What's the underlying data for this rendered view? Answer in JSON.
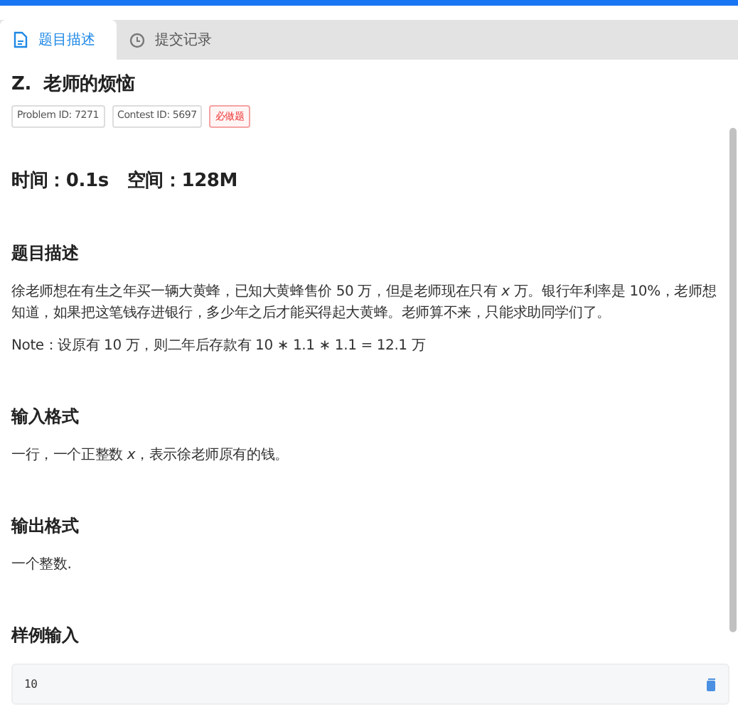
{
  "tabs": [
    {
      "label": "题目描述",
      "kind": "description",
      "selected": true
    },
    {
      "label": "提交记录",
      "kind": "submissions",
      "selected": false
    }
  ],
  "problem": {
    "title": "Z.  老师的烦恼",
    "tags": [
      {
        "label": "Problem ID: 7271",
        "kind": "plain"
      },
      {
        "label": "Contest ID: 5697",
        "kind": "plain"
      },
      {
        "label": "必做题",
        "kind": "required"
      }
    ],
    "limits": "时间：0.1s   空间：128M",
    "sections": [
      {
        "heading": "题目描述",
        "paragraphs": [
          "徐老师想在有生之年买一辆大黄蜂，已知大黄蜂售价 50 万，但是老师现在只有 *x* 万。银行年利率是 10%，老师想知道，如果把这笔钱存进银行，多少年之后才能买得起大黄蜂。老师算不来，只能求助同学们了。",
          "Note：设原有 10 万，则二年后存款有 10 ∗ 1.1 ∗ 1.1 = 12.1 万"
        ]
      },
      {
        "heading": "输入格式",
        "paragraphs": [
          "一行，一个正整数 *x*，表示徐老师原有的钱。"
        ]
      },
      {
        "heading": "输出格式",
        "paragraphs": [
          "一个整数."
        ]
      },
      {
        "heading": "样例输入",
        "code": "10"
      }
    ]
  }
}
